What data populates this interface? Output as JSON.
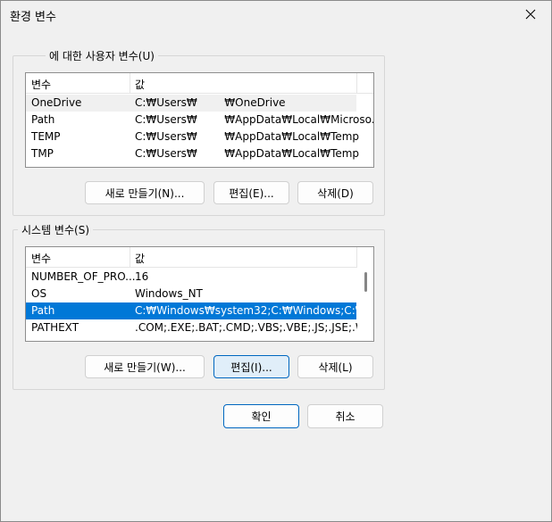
{
  "window": {
    "title": "환경 변수"
  },
  "user_vars": {
    "label": "에 대한 사용자 변수(U)",
    "headers": {
      "name": "변수",
      "value": "값"
    },
    "rows": [
      {
        "name": "OneDrive",
        "value": "C:₩Users₩        ₩OneDrive"
      },
      {
        "name": "Path",
        "value": "C:₩Users₩        ₩AppData₩Local₩Microso..."
      },
      {
        "name": "TEMP",
        "value": "C:₩Users₩        ₩AppData₩Local₩Temp"
      },
      {
        "name": "TMP",
        "value": "C:₩Users₩        ₩AppData₩Local₩Temp"
      }
    ],
    "buttons": {
      "new": "새로 만들기(N)...",
      "edit": "편집(E)...",
      "delete": "삭제(D)"
    }
  },
  "system_vars": {
    "label": "시스템 변수(S)",
    "headers": {
      "name": "변수",
      "value": "값"
    },
    "rows": [
      {
        "name": "NUMBER_OF_PRO...",
        "value": "16"
      },
      {
        "name": "OS",
        "value": "Windows_NT"
      },
      {
        "name": "Path",
        "value": "C:₩Windows₩system32;C:₩Windows;C:₩..."
      },
      {
        "name": "PATHEXT",
        "value": ".COM;.EXE;.BAT;.CMD;.VBS;.VBE;.JS;.JSE;.W..."
      }
    ],
    "buttons": {
      "new": "새로 만들기(W)...",
      "edit": "편집(I)...",
      "delete": "삭제(L)"
    }
  },
  "footer": {
    "ok": "확인",
    "cancel": "취소"
  },
  "colors": {
    "selection": "#0078d7",
    "focus_border": "#0067c0",
    "focus_bg": "#e0eef9"
  }
}
